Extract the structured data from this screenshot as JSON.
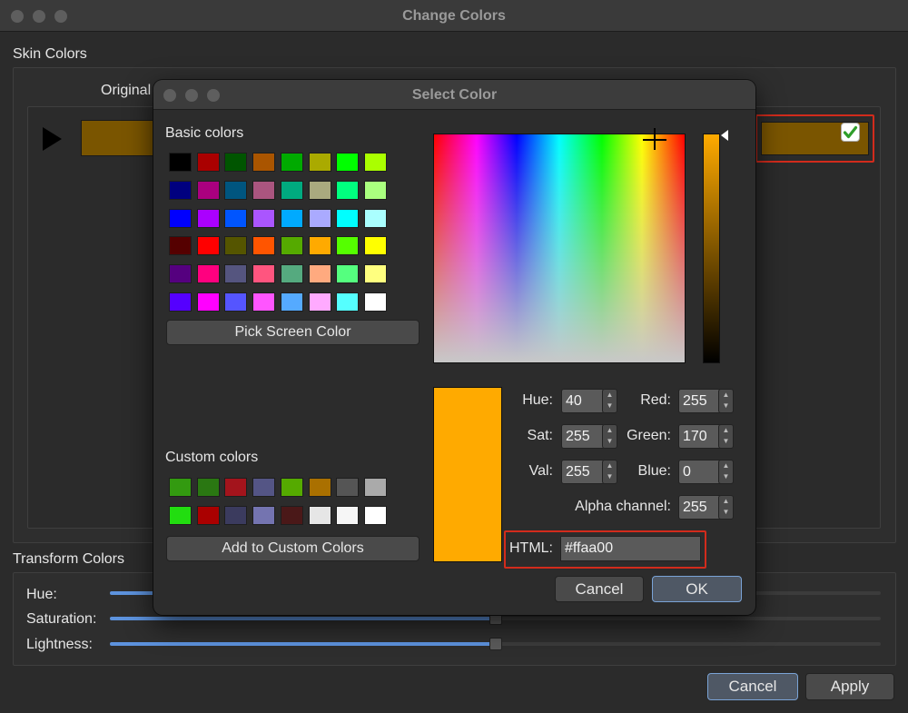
{
  "window": {
    "title": "Change Colors"
  },
  "skin_colors": {
    "label": "Skin Colors",
    "original_label": "Original",
    "original_color": "#7a5500",
    "new_color": "#7a5500",
    "checked": true
  },
  "transform": {
    "label": "Transform Colors",
    "sliders": [
      {
        "label": "Hue:",
        "value": 0.5
      },
      {
        "label": "Saturation:",
        "value": 0.5
      },
      {
        "label": "Lightness:",
        "value": 0.5
      }
    ]
  },
  "main_buttons": {
    "cancel": "Cancel",
    "apply": "Apply"
  },
  "dialog": {
    "title": "Select Color",
    "basic_colors_label": "Basic colors",
    "basic_colors": [
      [
        "#000000",
        "#aa0000",
        "#005500",
        "#aa5500",
        "#00aa00",
        "#aaaa00",
        "#00ff00",
        "#aaff00"
      ],
      [
        "#00007f",
        "#aa007f",
        "#00557f",
        "#aa557f",
        "#00aa7f",
        "#aaaa7f",
        "#00ff7f",
        "#aaff7f"
      ],
      [
        "#0000ff",
        "#aa00ff",
        "#0055ff",
        "#aa55ff",
        "#00aaff",
        "#aaaaff",
        "#00ffff",
        "#aaffff"
      ],
      [
        "#550000",
        "#ff0000",
        "#555500",
        "#ff5500",
        "#55aa00",
        "#ffaa00",
        "#55ff00",
        "#ffff00"
      ],
      [
        "#55007f",
        "#ff007f",
        "#55557f",
        "#ff557f",
        "#55aa7f",
        "#ffaa7f",
        "#55ff7f",
        "#ffff7f"
      ],
      [
        "#5500ff",
        "#ff00ff",
        "#5555ff",
        "#ff55ff",
        "#55aaff",
        "#ffaaff",
        "#55ffff",
        "#ffffff"
      ]
    ],
    "pick_screen_label": "Pick Screen Color",
    "custom_colors_label": "Custom colors",
    "custom_colors": [
      [
        "#339a10",
        "#2a7712",
        "#a3141c",
        "#545585",
        "#55aa00",
        "#aa7000",
        "#555555",
        "#aaaaaa"
      ],
      [
        "#22dd10",
        "#aa0000",
        "#3b3b5e",
        "#7474b0",
        "#4a1818",
        "#e6e6e6",
        "#f6f6f6",
        "#ffffff"
      ]
    ],
    "add_custom_label": "Add to Custom Colors",
    "current_color": "#ffaa00",
    "fields": {
      "hue": {
        "label": "Hue:",
        "value": "40"
      },
      "sat": {
        "label": "Sat:",
        "value": "255"
      },
      "val": {
        "label": "Val:",
        "value": "255"
      },
      "red": {
        "label": "Red:",
        "value": "255"
      },
      "green": {
        "label": "Green:",
        "value": "170"
      },
      "blue": {
        "label": "Blue:",
        "value": "0"
      },
      "alpha": {
        "label": "Alpha channel:",
        "value": "255"
      }
    },
    "html_label": "HTML:",
    "html_value": "#ffaa00",
    "cancel_label": "Cancel",
    "ok_label": "OK"
  }
}
